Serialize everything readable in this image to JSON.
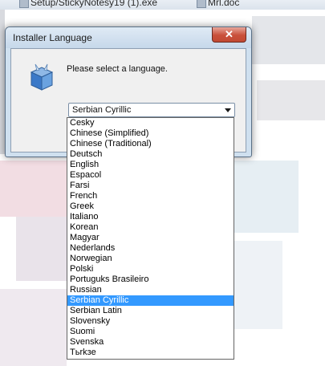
{
  "background": {
    "files": [
      {
        "name": "Setup/StickyNotesy19 (1).exe"
      },
      {
        "name": "Mrl.doc"
      }
    ]
  },
  "dialog": {
    "title": "Installer Language",
    "close_glyph": "✕",
    "prompt": "Please select a language.",
    "icon": "installer-box-icon",
    "select": {
      "value": "Serbian Cyrillic",
      "options": [
        "Cesky",
        "Chinese (Simplified)",
        "Chinese (Traditional)",
        "Deutsch",
        "English",
        "Espacol",
        "Farsi",
        "French",
        "Greek",
        "Italiano",
        "Korean",
        "Magyar",
        "Nederlands",
        "Norwegian",
        "Polski",
        "Portugukѕ Brasileiro",
        "Russian",
        "Serbian Cyrillic",
        "Serbian Latin",
        "Slovensky",
        "Suomi",
        "Svenska",
        "Tьrkзe"
      ],
      "selected_index": 17
    }
  },
  "colors": {
    "selection": "#3399ff",
    "close_button": "#c9503a",
    "window_frame": "#cfe0ef"
  }
}
